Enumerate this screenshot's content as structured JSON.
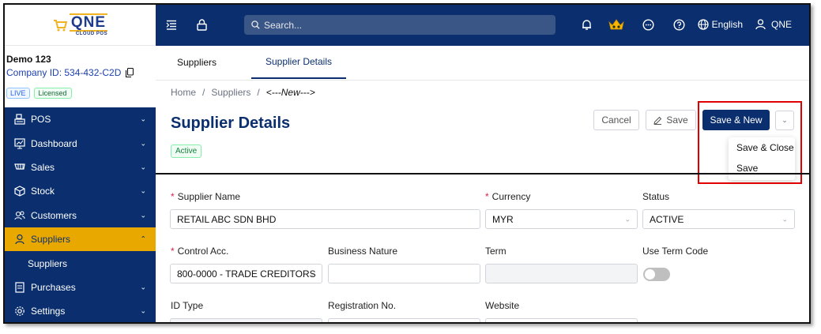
{
  "logo": {
    "main": "QNE",
    "sub": "CLOUD POS"
  },
  "company": {
    "name": "Demo 123",
    "id_label": "Company ID: 534-432-C2D",
    "badges": [
      "LIVE",
      "Licensed"
    ]
  },
  "sidebar": {
    "items": [
      {
        "label": "POS",
        "icon": "pos-icon"
      },
      {
        "label": "Dashboard",
        "icon": "dashboard-icon"
      },
      {
        "label": "Sales",
        "icon": "sales-icon"
      },
      {
        "label": "Stock",
        "icon": "stock-icon"
      },
      {
        "label": "Customers",
        "icon": "customers-icon"
      },
      {
        "label": "Suppliers",
        "icon": "suppliers-icon",
        "active": true
      },
      {
        "label": "Purchases",
        "icon": "purchases-icon"
      },
      {
        "label": "Settings",
        "icon": "settings-icon"
      }
    ],
    "submenu": {
      "label": "Suppliers"
    }
  },
  "topbar": {
    "search_placeholder": "Search...",
    "language": "English",
    "user": "QNE"
  },
  "tabs": [
    "Suppliers",
    "Supplier Details"
  ],
  "breadcrumb": [
    "Home",
    "Suppliers",
    "<---New--->"
  ],
  "page": {
    "title": "Supplier Details",
    "status": "Active"
  },
  "actions": {
    "cancel": "Cancel",
    "save": "Save",
    "save_new": "Save & New",
    "dropdown": [
      "Save & Close",
      "Save"
    ]
  },
  "form": {
    "supplier_name": {
      "label": "Supplier Name",
      "value": "RETAIL ABC SDN BHD"
    },
    "currency": {
      "label": "Currency",
      "value": "MYR"
    },
    "status": {
      "label": "Status",
      "value": "ACTIVE"
    },
    "control_acc": {
      "label": "Control Acc.",
      "value": "800-0000 - TRADE CREDITORS"
    },
    "business_nature": {
      "label": "Business Nature",
      "value": ""
    },
    "term": {
      "label": "Term",
      "value": ""
    },
    "use_term_code": {
      "label": "Use Term Code",
      "value": false
    },
    "id_type": {
      "label": "ID Type"
    },
    "registration_no": {
      "label": "Registration No."
    },
    "website": {
      "label": "Website"
    }
  },
  "colors": {
    "primary": "#0b2f6e",
    "accent": "#e8a800",
    "highlight": "#e00000"
  }
}
